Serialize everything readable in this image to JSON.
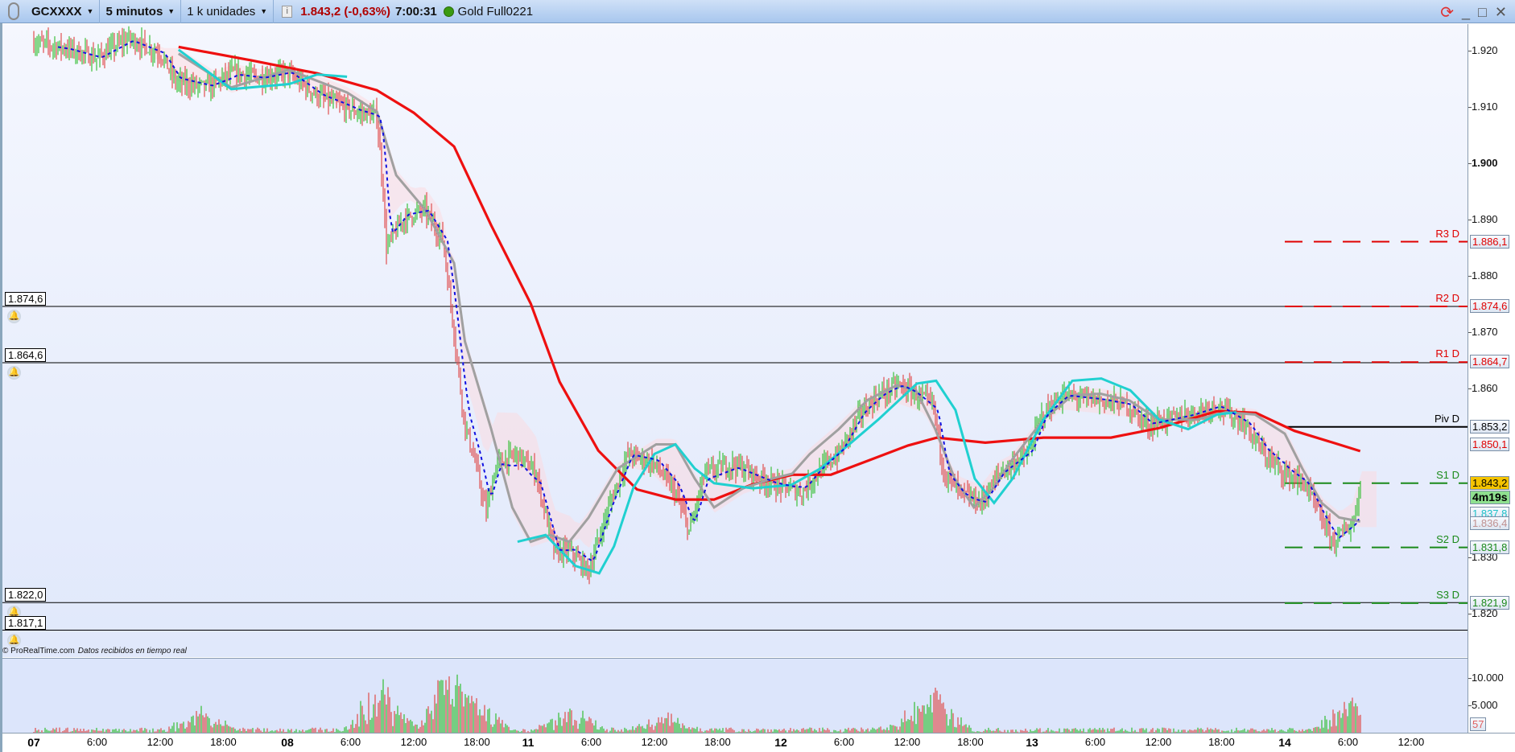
{
  "toolbar": {
    "symbol": "GCXXXX",
    "timeframe": "5 minutos",
    "units": "1 k unidades",
    "last_price": "1.843,2 (-0,63%)",
    "time": "7:00:31",
    "instrument": "Gold Full0221",
    "status_color": "#3a9a10"
  },
  "window_controls": {
    "refresh": "refresh-icon",
    "minimize": "_",
    "maximize": "□",
    "close": "✕"
  },
  "credit": {
    "site": "© ProRealTime.com",
    "note": "Datos recibidos en tiempo real"
  },
  "price_axis": {
    "ticks": [
      "1.920",
      "1.910",
      "1.900",
      "1.890",
      "1.880",
      "1.870",
      "1.860",
      "1.830",
      "1.820"
    ],
    "tick_values": [
      1920,
      1910,
      1900,
      1890,
      1880,
      1870,
      1860,
      1830,
      1820
    ]
  },
  "price_labels": [
    {
      "text": "1.886,1",
      "value": 1886.1,
      "color": "#e00000"
    },
    {
      "text": "1.874,6",
      "value": 1874.6,
      "color": "#e00000"
    },
    {
      "text": "1.864,7",
      "value": 1864.7,
      "color": "#e00000"
    },
    {
      "text": "1.853,2",
      "value": 1853.2,
      "color": "#000000"
    },
    {
      "text": "1.850,1",
      "value": 1850.1,
      "color": "#e00000"
    },
    {
      "text": "1.843,2",
      "value": 1843.2,
      "color": "#000000",
      "bg": "#f5c400"
    },
    {
      "text": "4m19s",
      "value": 1840.6,
      "color": "#000000",
      "bg": "#8fe08f",
      "bold": true
    },
    {
      "text": "1.837,8",
      "value": 1837.8,
      "color": "#20c0c8"
    },
    {
      "text": "1.836,4",
      "value": 1836.0,
      "color": "#c09090"
    },
    {
      "text": "1.831,8",
      "value": 1831.8,
      "color": "#1a8a1a"
    },
    {
      "text": "1.821,9",
      "value": 1821.9,
      "color": "#1a8a1a"
    }
  ],
  "alerts": [
    {
      "text": "1.874,6",
      "value": 1874.6
    },
    {
      "text": "1.864,6",
      "value": 1864.6
    },
    {
      "text": "1.822,0",
      "value": 1822.0
    },
    {
      "text": "1.817,1",
      "value": 1817.1
    }
  ],
  "pivots": [
    {
      "name": "R3 D",
      "value": 1886.1,
      "color": "#e00000",
      "dashed": true
    },
    {
      "name": "R2 D",
      "value": 1874.6,
      "color": "#e00000",
      "dashed": true
    },
    {
      "name": "R1 D",
      "value": 1864.7,
      "color": "#e00000",
      "dashed": true
    },
    {
      "name": "Piv D",
      "value": 1853.2,
      "color": "#000000",
      "dashed": false
    },
    {
      "name": "S1 D",
      "value": 1843.2,
      "color": "#1a8a1a",
      "dashed": true
    },
    {
      "name": "S2 D",
      "value": 1831.8,
      "color": "#1a8a1a",
      "dashed": true
    },
    {
      "name": "S3 D",
      "value": 1821.9,
      "color": "#1a8a1a",
      "dashed": true
    }
  ],
  "date_axis": [
    {
      "text": "07",
      "t": "07 00:00",
      "day": true
    },
    {
      "text": "6:00",
      "t": "07 06:00"
    },
    {
      "text": "12:00",
      "t": "07 12:00"
    },
    {
      "text": "18:00",
      "t": "07 18:00"
    },
    {
      "text": "08",
      "t": "08 00:00",
      "day": true
    },
    {
      "text": "6:00",
      "t": "08 06:00"
    },
    {
      "text": "12:00",
      "t": "08 12:00"
    },
    {
      "text": "18:00",
      "t": "08 18:00"
    },
    {
      "text": "11",
      "t": "11 00:00",
      "day": true
    },
    {
      "text": "6:00",
      "t": "11 06:00"
    },
    {
      "text": "12:00",
      "t": "11 12:00"
    },
    {
      "text": "18:00",
      "t": "11 18:00"
    },
    {
      "text": "12",
      "t": "12 00:00",
      "day": true
    },
    {
      "text": "6:00",
      "t": "12 06:00"
    },
    {
      "text": "12:00",
      "t": "12 12:00"
    },
    {
      "text": "18:00",
      "t": "12 18:00"
    },
    {
      "text": "13",
      "t": "13 00:00",
      "day": true
    },
    {
      "text": "6:00",
      "t": "13 06:00"
    },
    {
      "text": "12:00",
      "t": "13 12:00"
    },
    {
      "text": "18:00",
      "t": "13 18:00"
    },
    {
      "text": "14",
      "t": "14 00:00",
      "day": true
    },
    {
      "text": "6:00",
      "t": "14 06:00"
    },
    {
      "text": "12:00",
      "t": "14 12:00"
    }
  ],
  "volume_axis": {
    "ticks": [
      "10.000",
      "5.000"
    ],
    "tick_values": [
      10000,
      5000
    ],
    "last": "57",
    "last_color": "#e06060"
  },
  "chart_data": {
    "type": "line",
    "price": [
      [
        "07 00:00",
        1921.5
      ],
      [
        "07 03:00",
        1920.5
      ],
      [
        "07 06:00",
        1918.7
      ],
      [
        "07 09:00",
        1922.2
      ],
      [
        "07 12:00",
        1919.6
      ],
      [
        "07 13:30",
        1914.4
      ],
      [
        "07 16:30",
        1913.5
      ],
      [
        "07 19:00",
        1916.1
      ],
      [
        "07 21:30",
        1915.2
      ],
      [
        "08 00:00",
        1916.1
      ],
      [
        "08 03:00",
        1911.8
      ],
      [
        "08 06:30",
        1909.2
      ],
      [
        "08 08:30",
        1908.3
      ],
      [
        "08 09:10",
        1893.6
      ],
      [
        "08 09:20",
        1884.9
      ],
      [
        "08 11:00",
        1890.1
      ],
      [
        "08 13:00",
        1891.8
      ],
      [
        "08 14:45",
        1886.6
      ],
      [
        "08 15:40",
        1872.7
      ],
      [
        "08 16:30",
        1858.8
      ],
      [
        "10 18:00",
        1853.6
      ],
      [
        "10 19:00",
        1846.7
      ],
      [
        "10 20:00",
        1838.0
      ],
      [
        "10 21:00",
        1846.7
      ],
      [
        "10 23:00",
        1848.4
      ],
      [
        "11 00:45",
        1845.0
      ],
      [
        "11 02:30",
        1831.0
      ],
      [
        "11 04:00",
        1831.0
      ],
      [
        "11 05:45",
        1827.6
      ],
      [
        "11 07:30",
        1838.0
      ],
      [
        "11 09:30",
        1848.4
      ],
      [
        "11 12:00",
        1846.7
      ],
      [
        "11 14:00",
        1841.5
      ],
      [
        "11 15:20",
        1834.5
      ],
      [
        "11 16:45",
        1845.0
      ],
      [
        "11 19:30",
        1846.7
      ],
      [
        "11 23:00",
        1843.2
      ],
      [
        "12 02:00",
        1841.5
      ],
      [
        "12 03:30",
        1845.0
      ],
      [
        "12 05:30",
        1848.4
      ],
      [
        "12 07:30",
        1855.4
      ],
      [
        "12 09:20",
        1858.8
      ],
      [
        "12 11:10",
        1860.6
      ],
      [
        "12 13:00",
        1858.8
      ],
      [
        "12 14:30",
        1857.1
      ],
      [
        "12 15:30",
        1845.0
      ],
      [
        "12 17:00",
        1841.5
      ],
      [
        "12 19:00",
        1839.7
      ],
      [
        "12 20:45",
        1845.0
      ],
      [
        "12 23:30",
        1848.4
      ],
      [
        "13 01:00",
        1855.4
      ],
      [
        "13 03:00",
        1858.8
      ],
      [
        "13 06:30",
        1857.9
      ],
      [
        "13 09:00",
        1857.1
      ],
      [
        "13 11:00",
        1853.6
      ],
      [
        "13 14:45",
        1855.4
      ],
      [
        "13 17:30",
        1857.1
      ],
      [
        "13 20:15",
        1853.6
      ],
      [
        "13 22:00",
        1848.4
      ],
      [
        "14 00:00",
        1845.0
      ],
      [
        "14 01:50",
        1843.2
      ],
      [
        "14 03:40",
        1836.2
      ],
      [
        "14 04:40",
        1832.8
      ],
      [
        "14 06:30",
        1836.2
      ],
      [
        "14 07:15",
        1843.2
      ]
    ],
    "ma_red": [
      [
        "07 13:45",
        1920.7
      ],
      [
        "07 20:40",
        1918.3
      ],
      [
        "08 02:50",
        1916.0
      ],
      [
        "08 08:30",
        1913.0
      ],
      [
        "08 12:00",
        1909.0
      ],
      [
        "08 15:50",
        1903.0
      ],
      [
        "10 20:30",
        1889.0
      ],
      [
        "11 00:15",
        1875.1
      ],
      [
        "11 03:00",
        1861.2
      ],
      [
        "11 06:40",
        1849.0
      ],
      [
        "11 10:20",
        1842.1
      ],
      [
        "11 14:00",
        1840.3
      ],
      [
        "11 17:40",
        1840.3
      ],
      [
        "11 21:20",
        1843.0
      ],
      [
        "12 01:05",
        1844.7
      ],
      [
        "12 04:45",
        1844.7
      ],
      [
        "12 08:25",
        1847.3
      ],
      [
        "12 12:05",
        1849.9
      ],
      [
        "12 14:50",
        1851.3
      ],
      [
        "12 19:25",
        1850.4
      ],
      [
        "13 01:05",
        1851.3
      ],
      [
        "13 07:30",
        1851.3
      ],
      [
        "13 12:05",
        1853.0
      ],
      [
        "13 17:35",
        1856.0
      ],
      [
        "13 21:15",
        1855.7
      ],
      [
        "14 00:55",
        1852.5
      ],
      [
        "14 04:35",
        1850.4
      ],
      [
        "14 07:10",
        1848.9
      ]
    ],
    "ma_gray": [
      [
        "07 13:45",
        1919.5
      ],
      [
        "07 18:45",
        1913.5
      ],
      [
        "08 00:10",
        1916.6
      ],
      [
        "08 05:40",
        1912.6
      ],
      [
        "08 08:30",
        1909.2
      ],
      [
        "08 10:20",
        1897.9
      ],
      [
        "08 13:05",
        1891.8
      ],
      [
        "08 15:50",
        1882.3
      ],
      [
        "10 18:00",
        1868.4
      ],
      [
        "10 20:30",
        1852.8
      ],
      [
        "10 22:30",
        1838.9
      ],
      [
        "11 00:15",
        1832.8
      ],
      [
        "11 02:05",
        1834.0
      ],
      [
        "11 03:55",
        1832.8
      ],
      [
        "11 05:45",
        1837.1
      ],
      [
        "11 08:30",
        1845.8
      ],
      [
        "11 12:10",
        1850.1
      ],
      [
        "11 14:00",
        1850.1
      ],
      [
        "11 15:50",
        1844.0
      ],
      [
        "11 17:40",
        1838.9
      ],
      [
        "11 20:25",
        1842.3
      ],
      [
        "11 23:10",
        1844.0
      ],
      [
        "12 01:05",
        1844.9
      ],
      [
        "12 02:45",
        1848.4
      ],
      [
        "12 05:30",
        1852.8
      ],
      [
        "12 08:15",
        1858.0
      ],
      [
        "12 11:00",
        1860.6
      ],
      [
        "12 12:50",
        1859.7
      ],
      [
        "12 14:40",
        1852.8
      ],
      [
        "12 16:30",
        1844.1
      ],
      [
        "12 18:20",
        1838.9
      ],
      [
        "12 20:10",
        1842.3
      ],
      [
        "12 22:00",
        1847.5
      ],
      [
        "13 01:05",
        1854.5
      ],
      [
        "13 03:50",
        1858.8
      ],
      [
        "13 06:30",
        1859.1
      ],
      [
        "13 09:15",
        1857.9
      ],
      [
        "13 12:00",
        1854.5
      ],
      [
        "13 15:40",
        1854.5
      ],
      [
        "13 18:25",
        1855.8
      ],
      [
        "13 21:10",
        1855.4
      ],
      [
        "14 00:00",
        1852.0
      ],
      [
        "14 01:40",
        1845.8
      ],
      [
        "14 03:30",
        1839.7
      ],
      [
        "14 05:10",
        1837.1
      ],
      [
        "14 07:10",
        1836.4
      ]
    ],
    "ma_cyan": [
      [
        "07 13:45",
        1920.2
      ],
      [
        "07 18:45",
        1913.2
      ],
      [
        "08 00:10",
        1914.1
      ],
      [
        "08 02:50",
        1915.8
      ],
      [
        "08 05:40",
        1915.4
      ],
      [
        "10 23:00",
        1832.8
      ],
      [
        "11 01:40",
        1834.0
      ],
      [
        "11 04:30",
        1828.5
      ],
      [
        "11 06:45",
        1827.2
      ],
      [
        "11 08:10",
        1832.0
      ],
      [
        "11 10:00",
        1842.4
      ],
      [
        "11 12:00",
        1848.4
      ],
      [
        "11 14:00",
        1850.1
      ],
      [
        "11 15:50",
        1845.8
      ],
      [
        "11 17:40",
        1843.2
      ],
      [
        "11 21:20",
        1842.3
      ],
      [
        "12 01:00",
        1842.9
      ],
      [
        "12 03:45",
        1845.8
      ],
      [
        "12 06:30",
        1850.1
      ],
      [
        "12 09:15",
        1854.5
      ],
      [
        "12 12:55",
        1860.9
      ],
      [
        "12 14:45",
        1861.4
      ],
      [
        "12 16:35",
        1856.2
      ],
      [
        "12 18:25",
        1844.0
      ],
      [
        "12 20:15",
        1839.7
      ],
      [
        "12 22:00",
        1844.0
      ],
      [
        "13 01:05",
        1854.5
      ],
      [
        "13 03:50",
        1861.4
      ],
      [
        "13 06:35",
        1861.8
      ],
      [
        "13 09:20",
        1859.7
      ],
      [
        "13 12:05",
        1854.5
      ],
      [
        "13 14:50",
        1852.8
      ],
      [
        "13 17:35",
        1855.4
      ],
      [
        "13 19:25",
        1855.8
      ]
    ],
    "volume_spikes": [
      [
        "07 16:00",
        4500
      ],
      [
        "08 08:50",
        11000
      ],
      [
        "08 14:30",
        6500
      ],
      [
        "08 15:50",
        9000
      ],
      [
        "08 18:00",
        6000
      ],
      [
        "11 04:00",
        5000
      ],
      [
        "11 13:00",
        3500
      ],
      [
        "12 12:00",
        3000
      ],
      [
        "12 14:50",
        7800
      ],
      [
        "14 06:00",
        6500
      ]
    ]
  }
}
